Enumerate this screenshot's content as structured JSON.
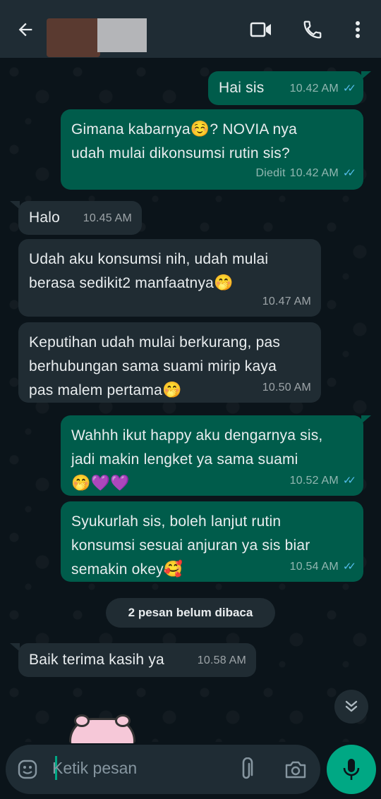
{
  "header": {
    "back_icon": "arrow-left-icon",
    "video_icon": "video-camera-icon",
    "call_icon": "phone-icon",
    "menu_icon": "kebab-menu-icon"
  },
  "messages": [
    {
      "dir": "out",
      "text": "Hai sis",
      "time": "10.42 AM",
      "edited": "",
      "ticks": "read"
    },
    {
      "dir": "out",
      "line1": "Gimana kabarnya",
      "emoji1": "☺️",
      "line1b": "? NOVIA nya",
      "line2": "udah mulai dikonsumsi rutin sis?",
      "time": "10.42 AM",
      "edited": "Diedit",
      "ticks": "read"
    },
    {
      "dir": "in",
      "text": "Halo",
      "time": "10.45 AM"
    },
    {
      "dir": "in",
      "line1": "Udah aku konsumsi nih, udah mulai",
      "line2": "berasa sedikit2 manfaatnya",
      "emoji": "🤭",
      "time": "10.47 AM"
    },
    {
      "dir": "in",
      "line1": "Keputihan udah mulai berkurang, pas",
      "line2": "berhubungan sama suami mirip kaya",
      "line3": "pas malem pertama",
      "emoji": "🤭",
      "time": "10.50 AM"
    },
    {
      "dir": "out",
      "line1": "Wahhh ikut happy aku dengarnya sis,",
      "line2": "jadi makin lengket ya sama suami",
      "emoji": "🤭💜💜",
      "time": "10.52 AM",
      "ticks": "read"
    },
    {
      "dir": "out",
      "line1": "Syukurlah sis, boleh lanjut rutin",
      "line2": "konsumsi sesuai anjuran ya sis biar",
      "line3": "semakin okey",
      "emoji": "🥰",
      "time": "10.54 AM",
      "ticks": "read"
    },
    {
      "dir": "in",
      "text": "Baik terima kasih ya",
      "time": "10.58 AM"
    }
  ],
  "unread_label": "2 pesan belum dibaca",
  "input": {
    "placeholder": "Ketik pesan",
    "emoji_icon": "emoji-icon",
    "attach_icon": "paperclip-icon",
    "camera_icon": "camera-icon",
    "mic_icon": "microphone-icon"
  },
  "colors": {
    "outgoing_bubble": "#005c4b",
    "incoming_bubble": "#202c33",
    "header": "#1f2c34",
    "accent": "#00a884",
    "read_ticks": "#53bdeb"
  }
}
